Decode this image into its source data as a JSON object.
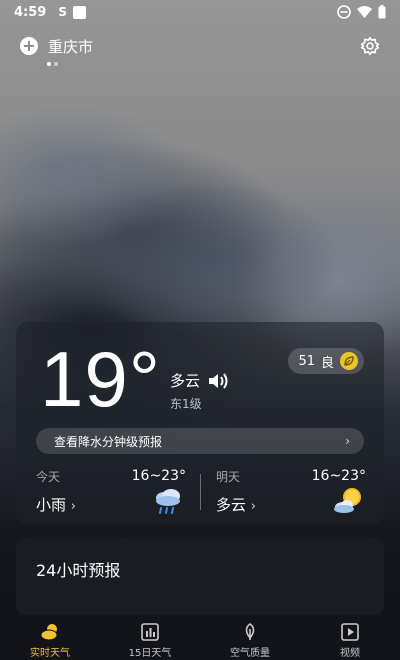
{
  "status_bar": {
    "time": "4:59",
    "sim": "S"
  },
  "header": {
    "city": "重庆市",
    "add_symbol": "+"
  },
  "current": {
    "temperature": "19°",
    "condition": "多云",
    "wind": "东1级",
    "aqi_value": "51",
    "aqi_label": "良",
    "minute_forecast_label": "查看降水分钟级预报",
    "chevron": "›"
  },
  "today": {
    "label": "今天",
    "condition": "小雨",
    "range": "16~23°",
    "chevron": "›"
  },
  "tomorrow": {
    "label": "明天",
    "condition": "多云",
    "range": "16~23°",
    "chevron": "›"
  },
  "hourly": {
    "title": "24小时预报"
  },
  "nav": [
    {
      "label": "实时天气",
      "icon": "weather-cloud-sun-icon",
      "active": true
    },
    {
      "label": "15日天气",
      "icon": "chart-bars-icon",
      "active": false
    },
    {
      "label": "空气质量",
      "icon": "leaf-icon",
      "active": false
    },
    {
      "label": "视频",
      "icon": "video-play-icon",
      "active": false
    }
  ],
  "colors": {
    "accent": "#f1c232",
    "aqi_leaf": "#e8c62b"
  }
}
